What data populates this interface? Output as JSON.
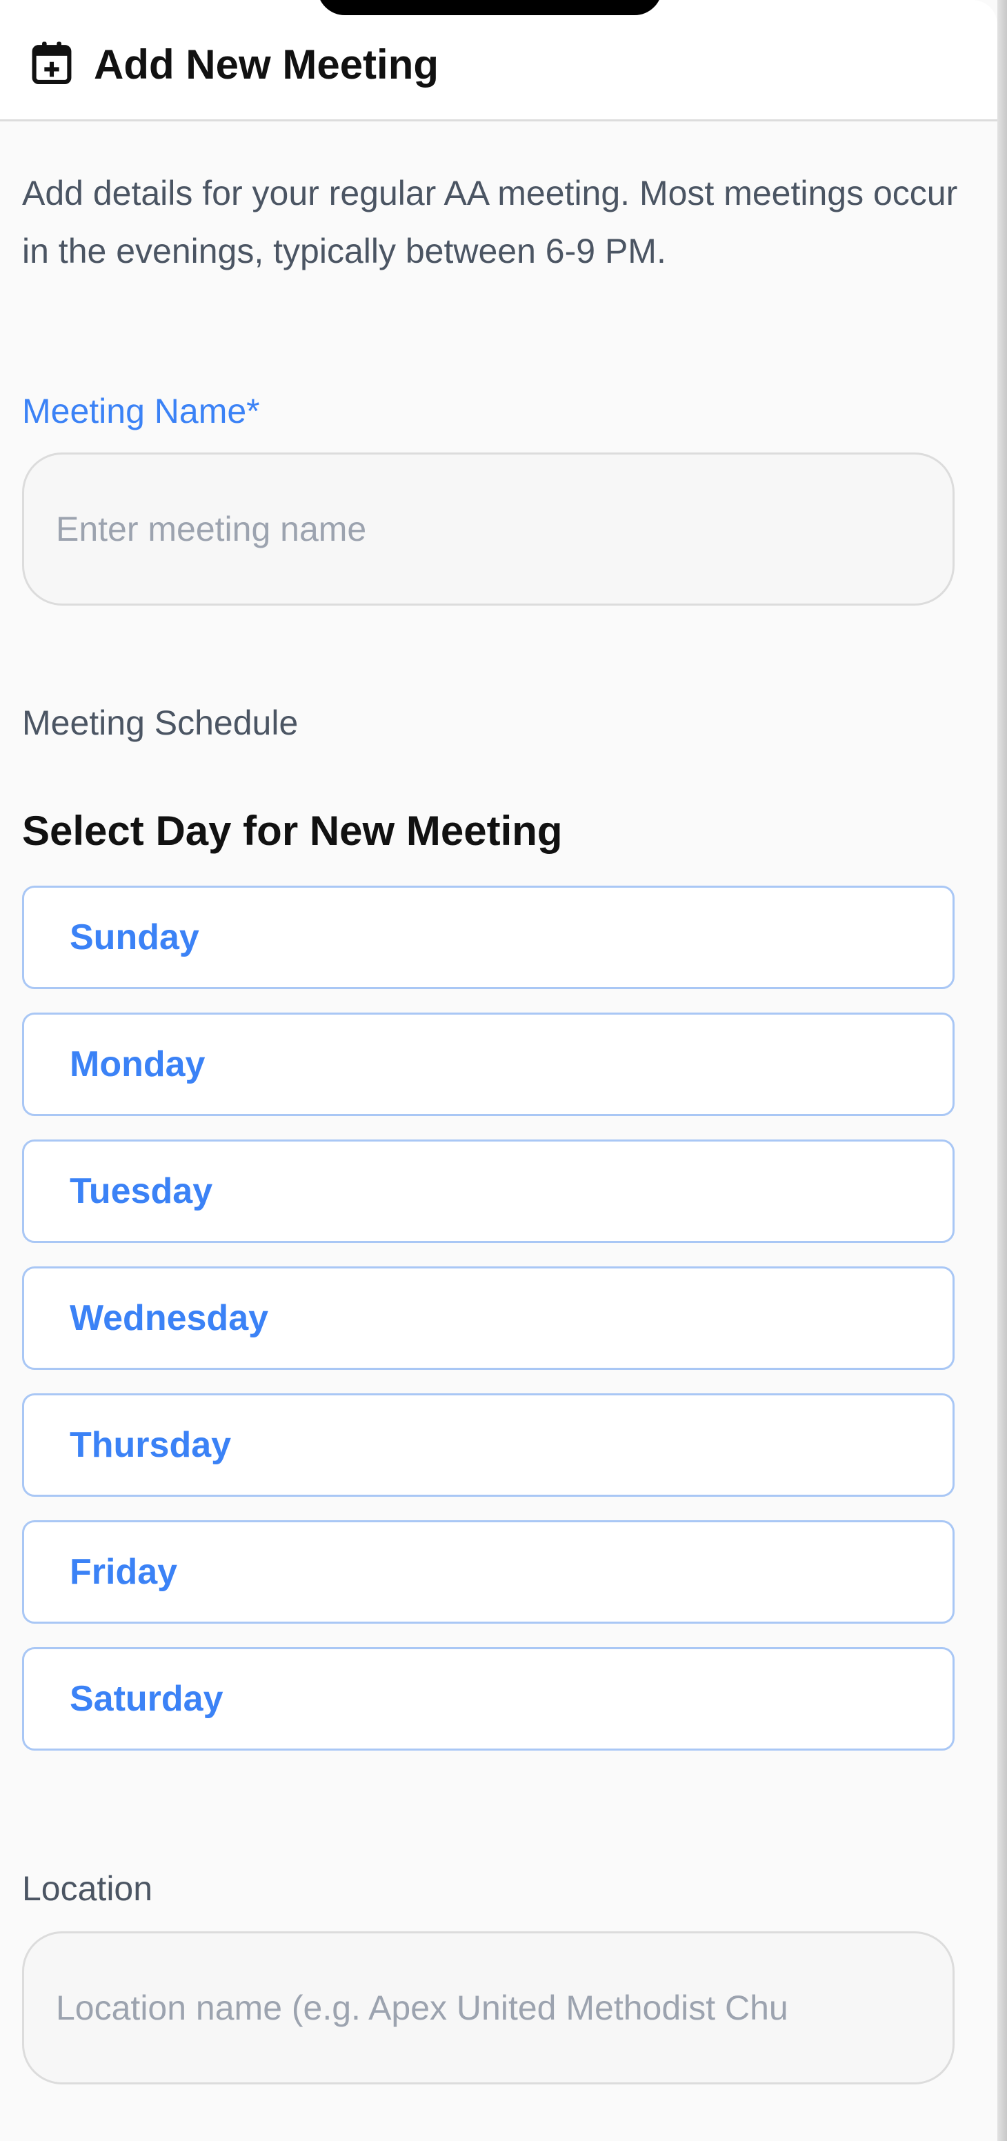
{
  "header": {
    "title": "Add New Meeting",
    "icon": "calendar-plus-icon"
  },
  "intro": "Add details for your regular AA meeting. Most meetings occur in the evenings, typically between 6-9 PM.",
  "meeting_name": {
    "label": "Meeting Name*",
    "placeholder": "Enter meeting name",
    "value": ""
  },
  "schedule": {
    "label": "Meeting Schedule",
    "heading": "Select Day for New Meeting",
    "days": [
      "Sunday",
      "Monday",
      "Tuesday",
      "Wednesday",
      "Thursday",
      "Friday",
      "Saturday"
    ]
  },
  "location": {
    "label": "Location",
    "placeholder": "Location name (e.g. Apex United Methodist Chu",
    "value": ""
  },
  "colors": {
    "accent": "#3b82f6",
    "text": "#111111",
    "muted": "#4b5563",
    "placeholder": "#9ca3af",
    "day_border": "#a9c7f5"
  }
}
